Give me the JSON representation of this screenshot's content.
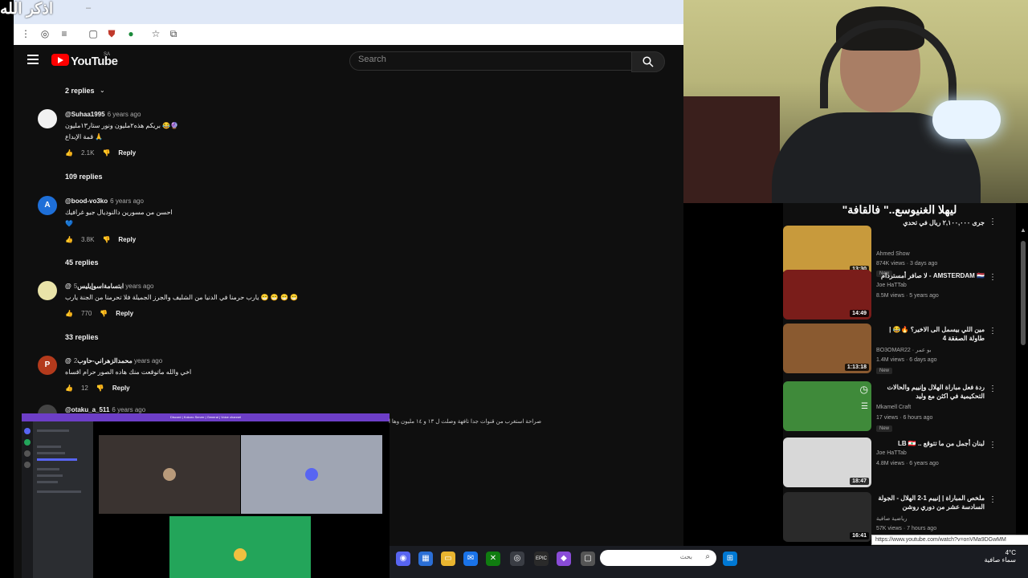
{
  "overlay": {
    "text": "اذكر الله"
  },
  "browser": {
    "minimize_glyph": "–"
  },
  "youtube": {
    "logo_text": "YouTube",
    "region": "SA",
    "search_placeholder": "Search",
    "comments": [
      {
        "replies_label": "2 replies"
      },
      {
        "author": "@Suhaa1995",
        "time": "6 years ago",
        "line1": "بريكم هذه٢مليون ونور ستار١٣مليون 😂🔮",
        "line2": "قمة الإبداع 🙏",
        "likes": "2.1K",
        "reply": "Reply",
        "avatar": "",
        "avatar_color": "#f1f1f1",
        "replies_label": "109 replies"
      },
      {
        "author": "@bood-vo3ko",
        "time": "6 years ago",
        "line1": "احسن من مسورين دالنوديال جيو غرافيك",
        "line2": "💙",
        "likes": "3.8K",
        "reply": "Reply",
        "avatar": "A",
        "avatar_color": "#1e6fd8",
        "replies_label": "45 replies"
      },
      {
        "author": "@ابتسامةاسوإيليس",
        "time": "5 years ago",
        "line1": "يارب حرمنا في الدنيا من الشليف والجرز الجميلة فلا تحرمنا من الجنة يارب 😁 😁 😁 😁",
        "line2": "",
        "likes": "770",
        "reply": "Reply",
        "avatar": "",
        "avatar_color": "#e9e3a8",
        "replies_label": "33 replies"
      },
      {
        "author": "@محمدالزهراني-حاوب",
        "time": "2 years ago",
        "line1": "اخي والله ماتوقعت منك هاده الصور حرام اقساه",
        "line2": "",
        "likes": "12",
        "reply": "Reply",
        "avatar": "P",
        "avatar_color": "#b33a1c",
        "replies_label": ""
      },
      {
        "author": "@otaku_a_511",
        "time": "6 years ago",
        "line1": "",
        "line2": "",
        "likes": "",
        "reply": "",
        "avatar": "",
        "avatar_color": "#444444",
        "replies_label": ""
      }
    ]
  },
  "sidebar": {
    "overlay_title": "\"ليهلا الغنيوسع..\" فالقافة",
    "videos": [
      {
        "title": "جرى ٢,١٠٠,٠٠٠ ريال في تحدي",
        "channel": "Ahmed Show",
        "meta": "874K views · 3 days ago",
        "badge": "New",
        "duration": "13:30",
        "thumb_color": "#c89a3c"
      },
      {
        "title": "AMSTERDAM 🇳🇱 - لا صافر أمستردام",
        "channel": "Joe HaTTab",
        "meta": "8.5M views · 5 years ago",
        "badge": "",
        "duration": "14:49",
        "thumb_color": "#7a1d1a"
      },
      {
        "title": "مين اللي بيسمل الى الاخير؟ 🔥😂 | طاولة الصفقة 4",
        "channel": "BO3OMAR22 · بو عمر",
        "meta": "1.4M views · 6 days ago",
        "badge": "New",
        "duration": "1:13:18",
        "thumb_color": "#8a5a30"
      },
      {
        "title": "ردة فعل مباراة الهلال وإنييم والحالات التحكيمية في اكثن مع وليد",
        "channel": "Mkamell Craft",
        "meta": "17 views · 6 hours ago",
        "badge": "New",
        "duration": "",
        "thumb_color": "#3f8a3a"
      },
      {
        "title": "لبنان أجمل من ما تتوقع .. LB 🇱🇧",
        "channel": "Joe HaTTab",
        "meta": "4.8M views · 6 years ago",
        "badge": "",
        "duration": "18:47",
        "thumb_color": "#d8d8d8"
      },
      {
        "title": "ملخص المباراة | إنييم 1-2 الهلال - الجولة السادسة عشر من دوري روشن",
        "channel": "رياضية صافية",
        "meta": "57K views · 7 hours ago",
        "badge": "",
        "duration": "16:41",
        "thumb_color": "#2a2a2a"
      }
    ],
    "url_tooltip": "https://www.youtube.com/watch?v=onVMa9DGwMM"
  },
  "discord": {
    "title": "Discord | Kokoro Server | General | Voice channel",
    "caption": "صراحة استغرب من قنوات جدا تافهة وصلت ل ١٣ و ١٤ مليون وها ا"
  },
  "taskbar": {
    "search_placeholder": "بحث",
    "temperature": "4°C",
    "weather": "سماء صافية"
  }
}
